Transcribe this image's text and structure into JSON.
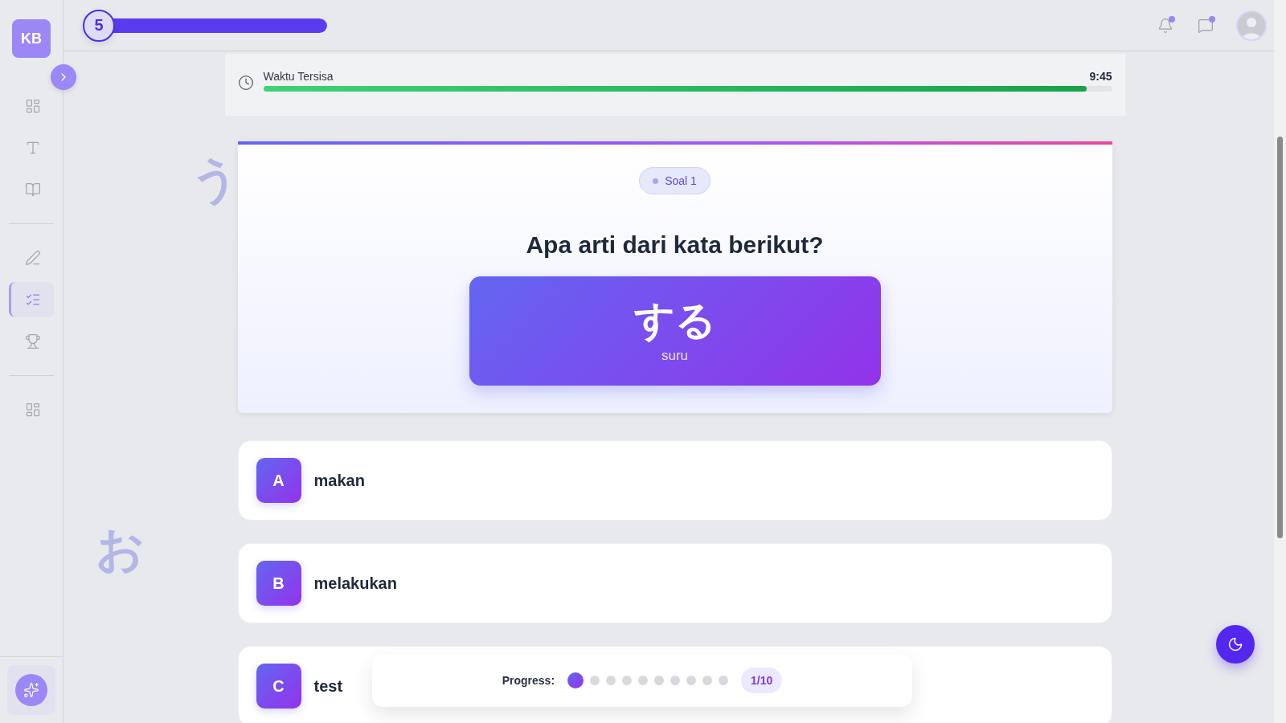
{
  "sidebar": {
    "logo": "KB",
    "groups": [
      {
        "items": [
          {
            "kind": "grid",
            "selected": false
          },
          {
            "kind": "text",
            "selected": false
          },
          {
            "kind": "book",
            "selected": false
          }
        ]
      },
      {
        "items": [
          {
            "kind": "pencil",
            "selected": false
          },
          {
            "kind": "checklist",
            "selected": true
          },
          {
            "kind": "trophy",
            "selected": false
          }
        ]
      },
      {
        "items": [
          {
            "kind": "grid",
            "selected": false
          }
        ]
      }
    ]
  },
  "header": {
    "level_badge": "5",
    "xp": {
      "level": 1
    },
    "notifications": {
      "unread": true
    },
    "messages": {
      "unread": true
    }
  },
  "timer": {
    "label": "Waktu Tersisa",
    "value": "9:45",
    "level": 0.97
  },
  "decorations": [
    {
      "char": "う"
    },
    {
      "char": "お"
    }
  ],
  "question": {
    "badge": "Soal 1",
    "prompt": "Apa arti dari kata berikut?",
    "word": "する",
    "reading": "suru"
  },
  "options": [
    {
      "letter": "A",
      "text": "makan",
      "selected": false
    },
    {
      "letter": "B",
      "text": "melakukan",
      "selected": false
    },
    {
      "letter": "C",
      "text": "test",
      "selected": false
    }
  ],
  "progress": {
    "label": "Progress:",
    "steps": [
      {
        "selected": true
      },
      {
        "selected": false
      },
      {
        "selected": false
      },
      {
        "selected": false
      },
      {
        "selected": false
      },
      {
        "selected": false
      },
      {
        "selected": false
      },
      {
        "selected": false
      },
      {
        "selected": false
      },
      {
        "selected": false
      }
    ],
    "counter": "1/10"
  }
}
